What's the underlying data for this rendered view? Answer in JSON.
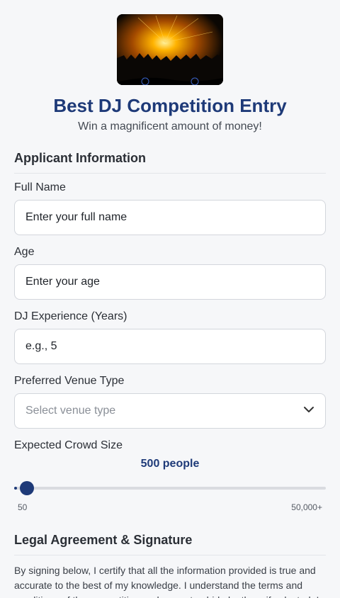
{
  "header": {
    "hero_image": "concert-crowd-stage-lights-image",
    "title": "Best DJ Competition Entry",
    "subtitle": "Win a magnificent amount of money!"
  },
  "applicant_section": {
    "title": "Applicant Information",
    "full_name": {
      "label": "Full Name",
      "placeholder": "Enter your full name"
    },
    "age": {
      "label": "Age",
      "placeholder": "Enter your age"
    },
    "experience": {
      "label": "DJ Experience (Years)",
      "placeholder": "e.g., 5"
    },
    "venue": {
      "label": "Preferred Venue Type",
      "placeholder": "Select venue type",
      "icon": "chevron-down-icon"
    },
    "crowd": {
      "label": "Expected Crowd Size",
      "value_text": "500 people",
      "min_label": "50",
      "max_label": "50,000+",
      "fill_fraction": 0.01
    }
  },
  "legal_section": {
    "title": "Legal Agreement & Signature",
    "text": "By signing below, I certify that all the information provided is true and accurate to the best of my knowledge. I understand the terms and conditions of the competition and agree to abide by them if selected. I"
  },
  "colors": {
    "accent": "#1e3a78",
    "background": "#f6f7f9",
    "border": "#d3d6dc"
  }
}
